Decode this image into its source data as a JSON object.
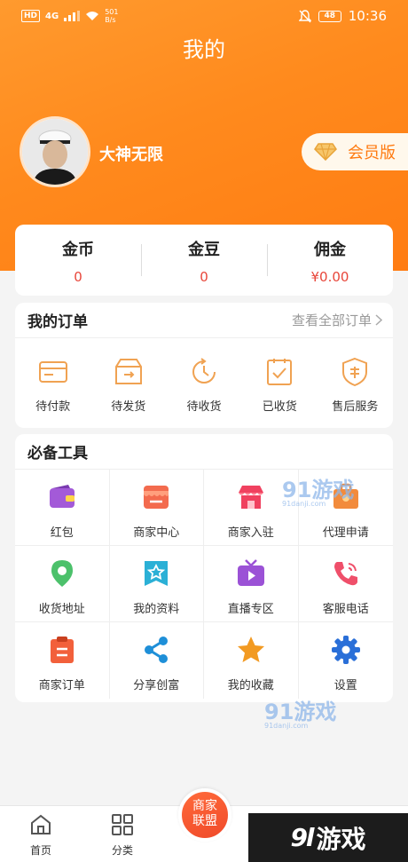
{
  "statusbar": {
    "hd": "HD",
    "net": "4G",
    "speed": "501",
    "speed_unit": "B/s",
    "battery": "48",
    "time": "10:36"
  },
  "header": {
    "title": "我的"
  },
  "profile": {
    "username": "大神无限",
    "vip_label": "会员版"
  },
  "stats": [
    {
      "label": "金币",
      "value": "0"
    },
    {
      "label": "金豆",
      "value": "0"
    },
    {
      "label": "佣金",
      "value": "¥0.00"
    }
  ],
  "orders": {
    "title": "我的订单",
    "view_all": "查看全部订单",
    "items": [
      {
        "label": "待付款",
        "icon": "wallet-card-icon"
      },
      {
        "label": "待发货",
        "icon": "box-send-icon"
      },
      {
        "label": "待收货",
        "icon": "clock-icon"
      },
      {
        "label": "已收货",
        "icon": "checkbox-icon"
      },
      {
        "label": "售后服务",
        "icon": "shield-icon"
      }
    ]
  },
  "tools": {
    "title": "必备工具",
    "items": [
      {
        "label": "红包",
        "icon": "wallet-icon"
      },
      {
        "label": "商家中心",
        "icon": "merchant-center-icon"
      },
      {
        "label": "商家入驻",
        "icon": "storefront-icon"
      },
      {
        "label": "代理申请",
        "icon": "agent-icon"
      },
      {
        "label": "收货地址",
        "icon": "location-pin-icon"
      },
      {
        "label": "我的资料",
        "icon": "profile-star-icon"
      },
      {
        "label": "直播专区",
        "icon": "tv-play-icon"
      },
      {
        "label": "客服电话",
        "icon": "phone-icon"
      },
      {
        "label": "商家订单",
        "icon": "clipboard-icon"
      },
      {
        "label": "分享创富",
        "icon": "share-icon"
      },
      {
        "label": "我的收藏",
        "icon": "star-icon"
      },
      {
        "label": "设置",
        "icon": "gear-icon"
      }
    ]
  },
  "watermark": {
    "brand": "91游戏",
    "domain": "91danji.com"
  },
  "tabbar": {
    "home": "首页",
    "category": "分类",
    "center_line1": "商家",
    "center_line2": "联盟"
  },
  "promo": {
    "num": "9l",
    "text": "游戏"
  },
  "colors": {
    "accent": "#ff8a1d",
    "price": "#e8463a",
    "order_icon": "#f0a252"
  }
}
